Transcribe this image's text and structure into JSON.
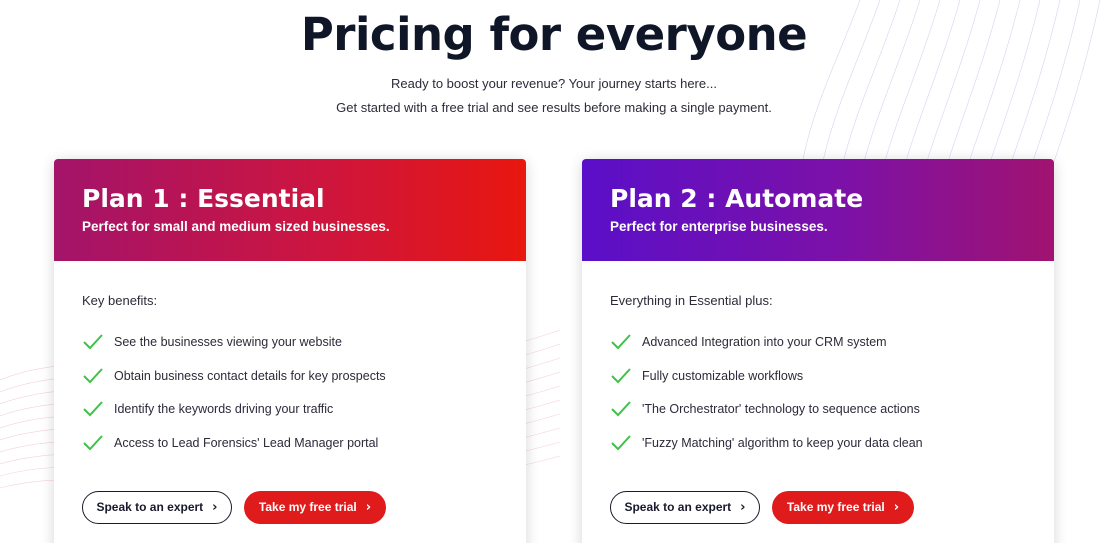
{
  "hero": {
    "title": "Pricing for everyone",
    "line1": "Ready to boost your revenue? Your journey starts here...",
    "line2": "Get started with a free trial and see results before making a single payment."
  },
  "plans": [
    {
      "title": "Plan 1 : Essential",
      "subtitle": "Perfect for small and medium sized businesses.",
      "intro": "Key benefits:",
      "benefits": [
        "See the businesses viewing your website",
        "Obtain business contact details for key prospects",
        "Identify the keywords driving your traffic",
        "Access to Lead Forensics' Lead Manager portal"
      ],
      "expert_label": "Speak to an expert",
      "trial_label": "Take my free trial"
    },
    {
      "title": "Plan 2 : Automate",
      "subtitle": "Perfect for enterprise businesses.",
      "intro": "Everything in Essential plus:",
      "benefits": [
        "Advanced Integration into your CRM system",
        "Fully customizable workflows",
        "'The Orchestrator' technology to sequence actions",
        "'Fuzzy Matching' algorithm to keep your data clean"
      ],
      "expert_label": "Speak to an expert",
      "trial_label": "Take my free trial"
    }
  ],
  "icons": {
    "benefit": "checkmark-icon",
    "button": "chevron-right-icon"
  },
  "colors": {
    "check": "#3ec24a",
    "trial_button": "#e01b1b",
    "plan1_gradient": [
      "#a3146a",
      "#e8170f"
    ],
    "plan2_gradient": [
      "#5a0fc8",
      "#a01370"
    ]
  }
}
